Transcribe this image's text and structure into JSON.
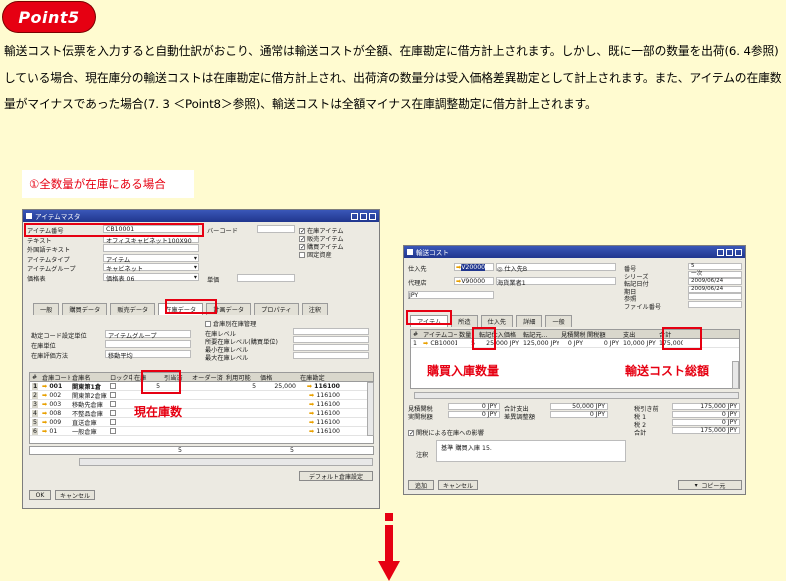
{
  "badge": {
    "label": "Point5"
  },
  "intro": {
    "text": "輸送コスト伝票を入力すると自動仕訳がおこり、通常は輸送コストが全額、在庫勘定に借方計上されます。しかし、既に一部の数量を出荷(6. 4参照)している場合、現在庫分の輸送コストは在庫勘定に借方計上され、出荷済の数量分は受入価格差異勘定として計上されます。また、アイテムの在庫数量がマイナスであった場合(7. 3 ＜Point8＞参照)、輸送コストは全額マイナス在庫調整勘定に借方計上されます。"
  },
  "case_title": "①全数量が在庫にある場合",
  "item_master": {
    "title": "アイテムマスタ",
    "fields": [
      {
        "label": "アイテム番号",
        "value": "CB10001"
      },
      {
        "label": "テキスト",
        "value": "オフィスキャビネット100X90"
      },
      {
        "label": "外国語テキスト",
        "value": ""
      },
      {
        "label": "アイテムタイプ",
        "value": "アイテム"
      },
      {
        "label": "アイテムグループ",
        "value": "キャビネット"
      },
      {
        "label": "価格表",
        "value": "価格表 06"
      }
    ],
    "barcode_label": "バーコード",
    "unit_price_label": "単価",
    "checks": [
      {
        "label": "在庫アイテム",
        "checked": true
      },
      {
        "label": "販売アイテム",
        "checked": true
      },
      {
        "label": "購買アイテム",
        "checked": true
      },
      {
        "label": "固定資産",
        "checked": false
      }
    ],
    "tabs": [
      "一般",
      "購買データ",
      "販売データ",
      "在庫データ",
      "計画データ",
      "プロパティ",
      "注釈"
    ],
    "active_tab": "在庫データ",
    "manage_by_wh": "倉庫別在庫管理",
    "left_settings": [
      {
        "label": "勘定コード設定単位",
        "value": "アイテムグループ"
      },
      {
        "label": "在庫単位",
        "value": ""
      },
      {
        "label": "在庫評価方法",
        "value": "移動平均"
      }
    ],
    "right_settings": [
      "在庫レベル",
      "所要在庫レベル(購買単位)",
      "最小在庫レベル",
      "最大在庫レベル"
    ],
    "columns": [
      "#",
      "倉庫コード",
      "倉庫名",
      "ロック中",
      "在庫",
      "引当済",
      "オーダー済",
      "利用可能",
      "価格",
      "在庫勘定"
    ],
    "rows": [
      {
        "no": "1",
        "code": "001",
        "name": "関東第1倉",
        "stock": "5",
        "avail": "5",
        "price": "25,000",
        "acct": "116100"
      },
      {
        "no": "2",
        "code": "002",
        "name": "関東第2倉庫",
        "stock": "",
        "avail": "",
        "price": "",
        "acct": "116100"
      },
      {
        "no": "3",
        "code": "003",
        "name": "移動先倉庫",
        "stock": "",
        "avail": "",
        "price": "",
        "acct": "116100"
      },
      {
        "no": "4",
        "code": "008",
        "name": "不整品倉庫",
        "stock": "",
        "avail": "",
        "price": "",
        "acct": "116100"
      },
      {
        "no": "5",
        "code": "009",
        "name": "直送倉庫",
        "stock": "",
        "avail": "",
        "price": "",
        "acct": "116100"
      },
      {
        "no": "6",
        "code": "01",
        "name": "一般倉庫",
        "stock": "",
        "avail": "",
        "price": "",
        "acct": "116100"
      }
    ],
    "total_stock": "5",
    "total_avail": "5",
    "btn_ok": "OK",
    "btn_cancel": "キャンセル",
    "btn_default_wh": "デフォルト倉庫設定"
  },
  "item_master_callout": "現在庫数",
  "landed_cost": {
    "title": "輸送コスト",
    "vendor_label": "仕入先",
    "vendor_code": "V20000",
    "vendor_name": "仕入先B",
    "agent_label": "代理店",
    "agent_code": "V90000",
    "agent_name": "海貨業者1",
    "currency": "JPY",
    "right_fields": [
      {
        "label": "番号",
        "value": "5"
      },
      {
        "label": "シリーズ",
        "value": "一次"
      },
      {
        "label": "転記日付",
        "value": "2009/06/24"
      },
      {
        "label": "期日",
        "value": "2009/06/24"
      },
      {
        "label": "参照",
        "value": ""
      },
      {
        "label": "ファイル番号",
        "value": ""
      }
    ],
    "tabs": [
      "アイテム",
      "所造",
      "仕入先",
      "詳細",
      "一般"
    ],
    "active_tab": "アイテム",
    "columns": [
      "#",
      "アイテムコード",
      "数量",
      "転記仕入価格",
      "転記元...",
      "見積関税",
      "関税額",
      "支出",
      "合計"
    ],
    "row": {
      "no": "1",
      "code": "CB10001",
      "qty": "5",
      "base_price": "25,000 JPY",
      "base_total": "125,000 JPY",
      "est_duty": "0 JPY",
      "duty": "0 JPY",
      "expense": "10,000 JPY",
      "total": "175,000"
    },
    "summary_left": [
      {
        "label": "見積関税",
        "value": "0 JPY"
      },
      {
        "label": "実関税額",
        "value": "0 JPY"
      }
    ],
    "summary_mid": [
      {
        "label": "合計支出",
        "value": "50,000 JPY"
      },
      {
        "label": "差異調整額",
        "value": "0 JPY"
      }
    ],
    "summary_right": [
      {
        "label": "税引き前",
        "value": "175,000 JPY"
      },
      {
        "label": "税 1",
        "value": "0 JPY"
      },
      {
        "label": "税 2",
        "value": "0 JPY"
      },
      {
        "label": "合計",
        "value": "175,000 JPY"
      }
    ],
    "stock_effect": "関税による在庫への影響",
    "remarks_label": "注釈",
    "remarks_text": "基準 購買入庫 15.",
    "btn_add": "追加",
    "btn_cancel": "キャンセル",
    "btn_copy": "コピー元"
  },
  "callout_qty": "購買入庫数量",
  "callout_total": "輸送コスト総額",
  "colors": {
    "accent": "#e60012",
    "background": "#fffbd0",
    "arrow": "#e8a000"
  }
}
